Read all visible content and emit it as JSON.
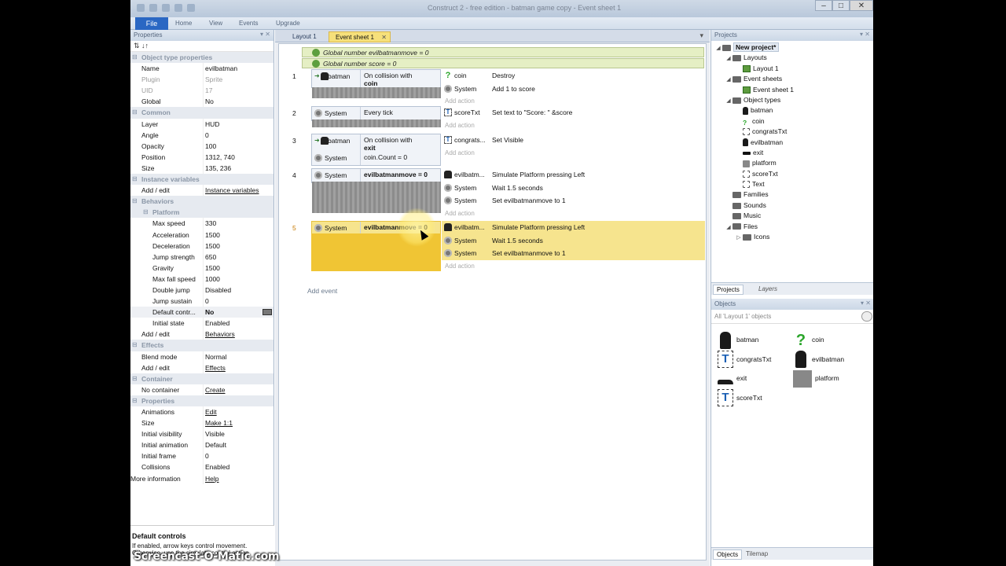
{
  "window": {
    "title": "Construct 2 - free edition - batman game copy - Event sheet 1",
    "min": "–",
    "max": "□",
    "close": "✕"
  },
  "ribbon": {
    "file": "File",
    "home": "Home",
    "view": "View",
    "events": "Events",
    "upgrade": "Upgrade"
  },
  "properties": {
    "header": "Properties",
    "toolbar": "⇅  ↓↑",
    "rows": [
      {
        "k": "Object type properties",
        "v": "",
        "type": "sec"
      },
      {
        "k": "Name",
        "v": "evilbatman"
      },
      {
        "k": "Plugin",
        "v": "Sprite",
        "type": "grey"
      },
      {
        "k": "UID",
        "v": "17",
        "type": "grey"
      },
      {
        "k": "Global",
        "v": "No"
      },
      {
        "k": "Common",
        "v": "",
        "type": "sec"
      },
      {
        "k": "Layer",
        "v": "HUD"
      },
      {
        "k": "Angle",
        "v": "0"
      },
      {
        "k": "Opacity",
        "v": "100"
      },
      {
        "k": "Position",
        "v": "1312, 740"
      },
      {
        "k": "Size",
        "v": "135, 236"
      },
      {
        "k": "Instance variables",
        "v": "",
        "type": "sec"
      },
      {
        "k": "Add / edit",
        "v": "Instance variables",
        "link": true
      },
      {
        "k": "Behaviors",
        "v": "",
        "type": "sec"
      },
      {
        "k": "Platform",
        "v": "",
        "type": "sec"
      },
      {
        "k": "Max speed",
        "v": "330",
        "type": "sub"
      },
      {
        "k": "Acceleration",
        "v": "1500",
        "type": "sub"
      },
      {
        "k": "Deceleration",
        "v": "1500",
        "type": "sub"
      },
      {
        "k": "Jump strength",
        "v": "650",
        "type": "sub"
      },
      {
        "k": "Gravity",
        "v": "1500",
        "type": "sub"
      },
      {
        "k": "Max fall speed",
        "v": "1000",
        "type": "sub"
      },
      {
        "k": "Double jump",
        "v": "Disabled",
        "type": "sub"
      },
      {
        "k": "Jump sustain",
        "v": "0",
        "type": "sub"
      },
      {
        "k": "Default contr...",
        "v": "No",
        "type": "subsel"
      },
      {
        "k": "Initial state",
        "v": "Enabled",
        "type": "sub"
      },
      {
        "k": "Add / edit",
        "v": "Behaviors",
        "link": true
      },
      {
        "k": "Effects",
        "v": "",
        "type": "sec"
      },
      {
        "k": "Blend mode",
        "v": "Normal"
      },
      {
        "k": "Add / edit",
        "v": "Effects",
        "link": true
      },
      {
        "k": "Container",
        "v": "",
        "type": "sec"
      },
      {
        "k": "No container",
        "v": "Create",
        "link": true
      },
      {
        "k": "Properties",
        "v": "",
        "type": "sec"
      },
      {
        "k": "Animations",
        "v": "Edit",
        "link": true
      },
      {
        "k": "Size",
        "v": "Make 1:1",
        "link": true
      },
      {
        "k": "Initial visibility",
        "v": "Visible"
      },
      {
        "k": "Initial animation",
        "v": "Default"
      },
      {
        "k": "Initial frame",
        "v": "0"
      },
      {
        "k": "Collisions",
        "v": "Enabled"
      },
      {
        "k": "More information",
        "v": "Help",
        "link": true,
        "type": "top"
      }
    ],
    "desc_title": "Default controls",
    "desc_text": "If enabled, arrow keys control movement. Otherwise, use the simulate control action."
  },
  "doctabs": {
    "layout": "Layout 1",
    "events": "Event sheet 1",
    "close": "✕",
    "dropdown": "▾"
  },
  "events": {
    "globals": [
      "Global number evilbatmanmove = 0",
      "Global number score = 0"
    ],
    "globals_bold": [
      "evilbatmanmove",
      "score"
    ],
    "add_action": "Add action",
    "add_event": "Add event",
    "list": [
      {
        "num": "1",
        "conds": [
          {
            "obj": "batman",
            "txt": "On collision with ",
            "bold": "coin"
          }
        ],
        "acts": [
          {
            "obj": "coin",
            "txt": "Destroy"
          },
          {
            "obj": "System",
            "txt": "Add 1 to score"
          }
        ]
      },
      {
        "num": "2",
        "conds": [
          {
            "obj": "System",
            "txt": "Every tick",
            "bold": ""
          }
        ],
        "acts": [
          {
            "obj": "scoreTxt",
            "txt": "Set text to \"Score: \" &score"
          }
        ]
      },
      {
        "num": "3",
        "conds": [
          {
            "obj": "batman",
            "txt": "On collision with ",
            "bold": "exit"
          },
          {
            "obj": "System",
            "txt": "coin.Count = 0",
            "bold": ""
          }
        ],
        "acts": [
          {
            "obj": "congrats...",
            "txt": "Set Visible"
          }
        ]
      },
      {
        "num": "4",
        "conds": [
          {
            "obj": "System",
            "txt": "",
            "bold": "evilbatmanmove = 0"
          }
        ],
        "acts": [
          {
            "obj": "evilbatm...",
            "txt": "Simulate  Platform pressing Left"
          },
          {
            "obj": "System",
            "txt": "Wait 1.5 seconds"
          },
          {
            "obj": "System",
            "txt": "Set evilbatmanmove to 1"
          }
        ]
      },
      {
        "num": "5",
        "conds": [
          {
            "obj": "System",
            "txt": "",
            "bold": "evilbatmanmove = 0"
          }
        ],
        "acts": [
          {
            "obj": "evilbatm...",
            "txt": "Simulate  Platform pressing Left"
          },
          {
            "obj": "System",
            "txt": "Wait 1.5 seconds"
          },
          {
            "obj": "System",
            "txt": "Set evilbatmanmove to 1"
          }
        ]
      }
    ]
  },
  "projects": {
    "header": "Projects",
    "tree": [
      {
        "label": "New project*",
        "depth": 0,
        "icon": "folder",
        "bold": true
      },
      {
        "label": "Layouts",
        "depth": 1,
        "icon": "folder"
      },
      {
        "label": "Layout 1",
        "depth": 2,
        "icon": "sheet"
      },
      {
        "label": "Event sheets",
        "depth": 1,
        "icon": "folder"
      },
      {
        "label": "Event sheet 1",
        "depth": 2,
        "icon": "sheet"
      },
      {
        "label": "Object types",
        "depth": 1,
        "icon": "folder"
      },
      {
        "label": "batman",
        "depth": 2,
        "icon": "bat"
      },
      {
        "label": "coin",
        "depth": 2,
        "icon": "coin"
      },
      {
        "label": "congratsTxt",
        "depth": 2,
        "icon": "T"
      },
      {
        "label": "evilbatman",
        "depth": 2,
        "icon": "bat"
      },
      {
        "label": "exit",
        "depth": 2,
        "icon": "exit"
      },
      {
        "label": "platform",
        "depth": 2,
        "icon": "plat"
      },
      {
        "label": "scoreTxt",
        "depth": 2,
        "icon": "T"
      },
      {
        "label": "Text",
        "depth": 2,
        "icon": "T"
      },
      {
        "label": "Families",
        "depth": 1,
        "icon": "folder"
      },
      {
        "label": "Sounds",
        "depth": 1,
        "icon": "folder"
      },
      {
        "label": "Music",
        "depth": 1,
        "icon": "folder"
      },
      {
        "label": "Files",
        "depth": 1,
        "icon": "folder"
      },
      {
        "label": "Icons",
        "depth": 2,
        "icon": "folder"
      }
    ],
    "tab_projects": "Projects",
    "tab_layers": "Layers"
  },
  "objects": {
    "header": "Objects",
    "filter": "All 'Layout 1' objects",
    "items": [
      {
        "label": "batman",
        "icon": "bat"
      },
      {
        "label": "coin",
        "icon": "coin"
      },
      {
        "label": "congratsTxt",
        "icon": "T"
      },
      {
        "label": "evilbatman",
        "icon": "bat"
      },
      {
        "label": "exit",
        "icon": "exit"
      },
      {
        "label": "platform",
        "icon": "plat"
      },
      {
        "label": "scoreTxt",
        "icon": "T"
      }
    ],
    "tab_objects": "Objects",
    "tab_tilemap": "Tilemap"
  },
  "watermark": "Screencast-O-Matic.com",
  "colors": {
    "accent": "#2a67c3",
    "highlight": "#f0c534",
    "global_var": "#e5efc4"
  }
}
